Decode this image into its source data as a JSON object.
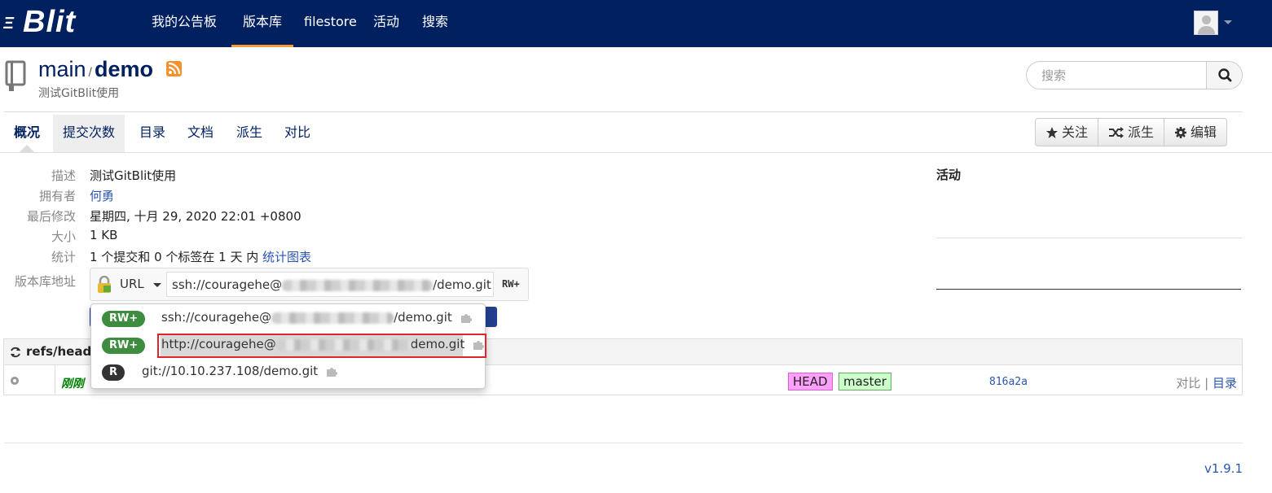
{
  "app": {
    "logo_prefix": "Ξ",
    "logo_text": "Blit"
  },
  "nav": {
    "items": [
      {
        "label": "我的公告板"
      },
      {
        "label": "版本库"
      },
      {
        "label": "filestore"
      },
      {
        "label": "活动"
      },
      {
        "label": "搜索"
      }
    ],
    "active_index": 1
  },
  "repo": {
    "project": "main",
    "separator": "/",
    "name": "demo",
    "description": "测试GitBlit使用"
  },
  "search": {
    "placeholder": "搜索"
  },
  "tabs": [
    {
      "label": "概况"
    },
    {
      "label": "提交次数"
    },
    {
      "label": "目录"
    },
    {
      "label": "文档"
    },
    {
      "label": "派生"
    },
    {
      "label": "对比"
    }
  ],
  "actions": {
    "watch_label": "关注",
    "fork_label": "派生",
    "edit_label": "编辑"
  },
  "details": {
    "description_label": "描述",
    "description_value": "测试GitBlit使用",
    "owner_label": "拥有者",
    "owner_value": "何勇",
    "last_change_label": "最后修改",
    "last_change_value": "星期四, 十月 29, 2020 22:01 +0800",
    "size_label": "大小",
    "size_value": "1 KB",
    "stats_label": "统计",
    "stats_value": "1 个提交和 0 个标签在 1 天 内",
    "stats_link": "统计图表",
    "url_label": "版本库地址"
  },
  "url_panel": {
    "protocol_label": "URL",
    "url_start": "ssh://couragehe@",
    "url_end": "/demo.git",
    "permission": "RW+"
  },
  "url_menu": {
    "items": [
      {
        "badge": "RW+",
        "start": "ssh://couragehe@",
        "end": "/demo.git"
      },
      {
        "badge": "RW+",
        "start": "http://couragehe@",
        "end": "demo.git"
      },
      {
        "badge": "R",
        "start": "git://10.10.237.108/demo.git",
        "end": ""
      }
    ],
    "selected_index": 1
  },
  "refs": {
    "header": "refs/heads",
    "row": {
      "date": "刚刚",
      "tag_head": "HEAD",
      "tag_branch": "master",
      "sha": "816a2a",
      "link_compare": "对比",
      "link_separator": "|",
      "link_tree": "目录"
    }
  },
  "activity": {
    "title": "活动"
  },
  "footer": {
    "version": "v1.9.1"
  },
  "colors": {
    "topbar": "#002060",
    "nav_active_underline": "#f0a030",
    "link": "#2a56b0",
    "badge_rw": "#3d8c40",
    "badge_r": "#333333",
    "selection_outline": "#e0262b",
    "tag_head": "#ffa0ff",
    "tag_branch": "#ccffcc"
  },
  "icons": {
    "repo": "book-icon",
    "rss": "rss-icon",
    "search": "magnifier-icon",
    "watch": "star-icon",
    "fork": "shuffle-icon",
    "edit": "gear-icon",
    "lock": "lock-icon",
    "copy": "puzzle-icon",
    "refresh": "refresh-icon"
  }
}
